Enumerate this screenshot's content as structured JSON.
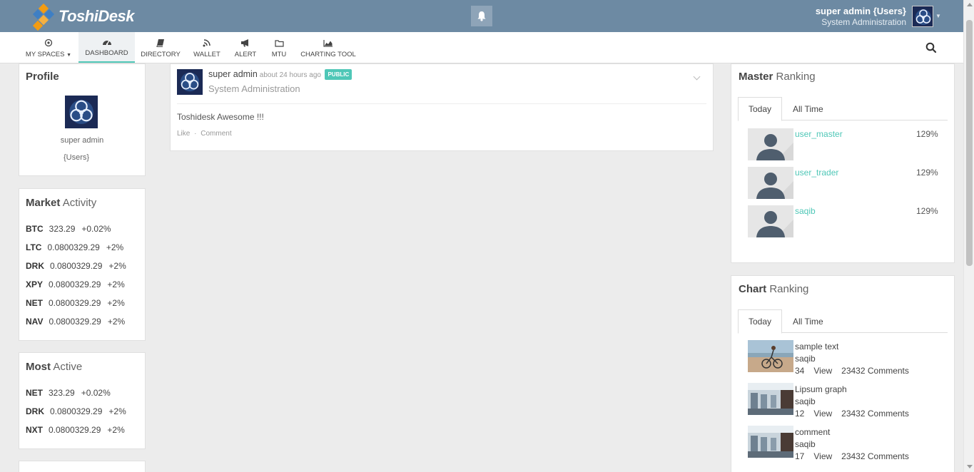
{
  "app": {
    "name": "ToshiDesk"
  },
  "header": {
    "user_name": "super admin {Users}",
    "user_role": "System Administration"
  },
  "nav": {
    "items": [
      {
        "label": "MY SPACES",
        "icon": "circle-dot-icon"
      },
      {
        "label": "DASHBOARD",
        "icon": "dashboard-gauge-icon"
      },
      {
        "label": "DIRECTORY",
        "icon": "book-icon"
      },
      {
        "label": "WALLET",
        "icon": "signal-icon"
      },
      {
        "label": "ALERT",
        "icon": "megaphone-icon"
      },
      {
        "label": "MTU",
        "icon": "folder-icon"
      },
      {
        "label": "CHARTING TOOL",
        "icon": "area-chart-icon"
      }
    ]
  },
  "profile": {
    "title": "Profile",
    "name": "super admin",
    "group": "{Users}"
  },
  "market_activity": {
    "title_bold": "Market",
    "title_rest": "Activity",
    "rows": [
      {
        "symbol": "BTC",
        "value": "323.29",
        "change": "+0.02%"
      },
      {
        "symbol": "LTC",
        "value": "0.0800329.29",
        "change": "+2%"
      },
      {
        "symbol": "DRK",
        "value": "0.0800329.29",
        "change": "+2%"
      },
      {
        "symbol": "XPY",
        "value": "0.0800329.29",
        "change": "+2%"
      },
      {
        "symbol": "NET",
        "value": "0.0800329.29",
        "change": "+2%"
      },
      {
        "symbol": "NAV",
        "value": "0.0800329.29",
        "change": "+2%"
      }
    ]
  },
  "most_active": {
    "title_bold": "Most",
    "title_rest": "Active",
    "rows": [
      {
        "symbol": "NET",
        "value": "323.29",
        "change": "+0.02%"
      },
      {
        "symbol": "DRK",
        "value": "0.0800329.29",
        "change": "+2%"
      },
      {
        "symbol": "NXT",
        "value": "0.0800329.29",
        "change": "+2%"
      }
    ]
  },
  "post": {
    "author": "super admin",
    "time": "about 24 hours ago",
    "badge": "PUBLIC",
    "subtitle": "System Administration",
    "text": "Toshidesk Awesome !!!",
    "like": "Like",
    "sep": "·",
    "comment": "Comment"
  },
  "master_ranking": {
    "title_bold": "Master",
    "title_rest": "Ranking",
    "tabs": [
      "Today",
      "All Time"
    ],
    "rows": [
      {
        "name": "user_master",
        "pct": "129%"
      },
      {
        "name": "user_trader",
        "pct": "129%"
      },
      {
        "name": "saqib",
        "pct": "129%"
      }
    ]
  },
  "chart_ranking": {
    "title_bold": "Chart",
    "title_rest": "Ranking",
    "tabs": [
      "Today",
      "All Time"
    ],
    "rows": [
      {
        "title": "sample text",
        "user": "saqib",
        "count": "34",
        "view": "View",
        "comments": "23432 Comments"
      },
      {
        "title": "Lipsum graph",
        "user": "saqib",
        "count": "12",
        "view": "View",
        "comments": "23432 Comments"
      },
      {
        "title": "comment",
        "user": "saqib",
        "count": "17",
        "view": "View",
        "comments": "23432 Comments"
      }
    ]
  },
  "colors": {
    "header_bg": "#6d8aa3",
    "accent": "#4fc7b7",
    "page_bg": "#ececec"
  }
}
